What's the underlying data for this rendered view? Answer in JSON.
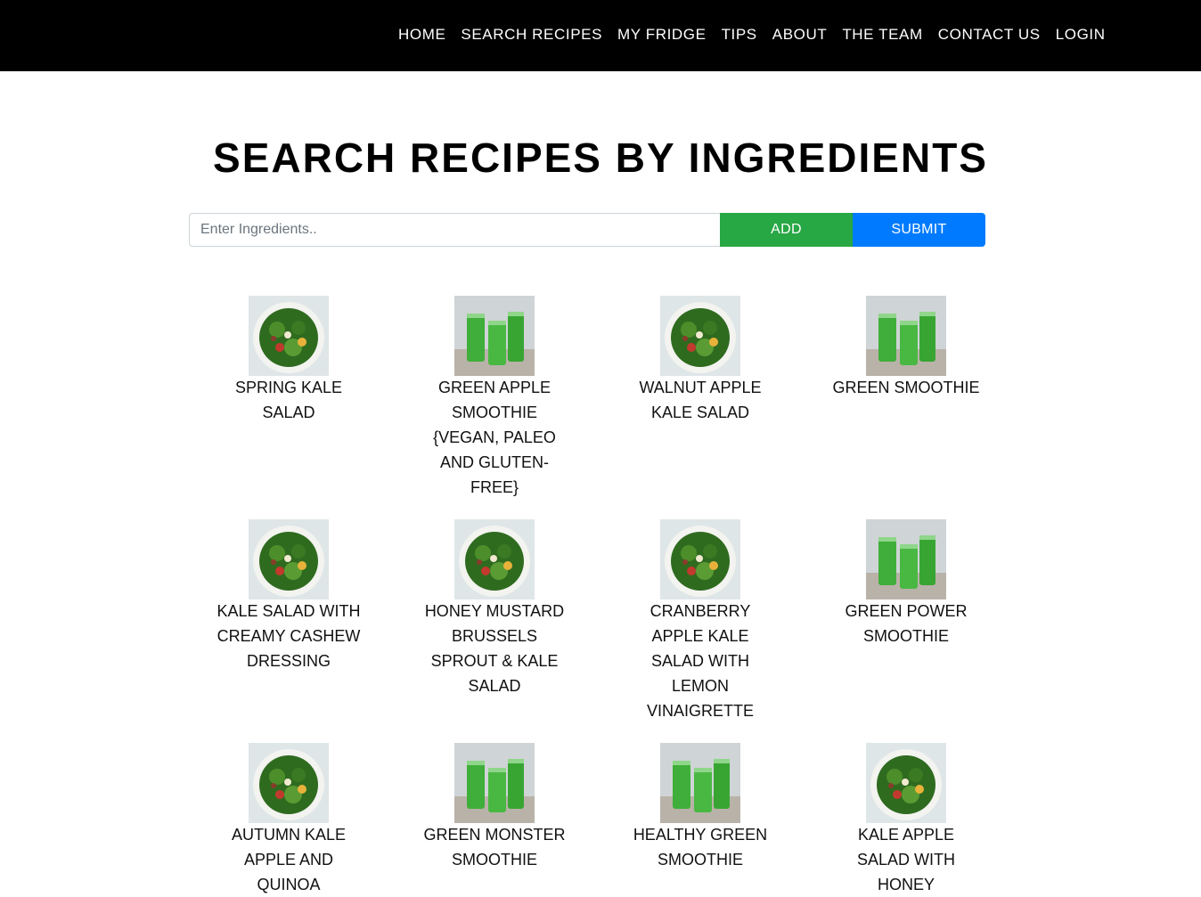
{
  "nav": {
    "items": [
      "HOME",
      "SEARCH RECIPES",
      "MY FRIDGE",
      "TIPS",
      "ABOUT",
      "THE TEAM",
      "CONTACT US",
      "LOGIN"
    ]
  },
  "page": {
    "title": "SEARCH RECIPES BY INGREDIENTS"
  },
  "search": {
    "placeholder": "Enter Ingredients..",
    "value": "",
    "add_label": "ADD",
    "submit_label": "SUBMIT"
  },
  "colors": {
    "navbar": "#000000",
    "add_button": "#28a745",
    "submit_button": "#007bff"
  },
  "recipes": [
    {
      "title": "SPRING KALE SALAD",
      "image": "salad-photo"
    },
    {
      "title": "GREEN APPLE SMOOTHIE {VEGAN, PALEO AND GLUTEN-FREE}",
      "image": "smoothie-photo"
    },
    {
      "title": "WALNUT APPLE KALE SALAD",
      "image": "salad-photo"
    },
    {
      "title": "GREEN SMOOTHIE",
      "image": "smoothie-photo"
    },
    {
      "title": "KALE SALAD WITH CREAMY CASHEW DRESSING",
      "image": "salad-photo"
    },
    {
      "title": "HONEY MUSTARD BRUSSELS SPROUT & KALE SALAD",
      "image": "salad-photo"
    },
    {
      "title": "CRANBERRY APPLE KALE SALAD WITH LEMON VINAIGRETTE",
      "image": "salad-photo"
    },
    {
      "title": "GREEN POWER SMOOTHIE",
      "image": "smoothie-photo"
    },
    {
      "title": "AUTUMN KALE APPLE AND QUINOA",
      "image": "salad-photo"
    },
    {
      "title": "GREEN MONSTER SMOOTHIE",
      "image": "smoothie-photo"
    },
    {
      "title": "HEALTHY GREEN SMOOTHIE",
      "image": "smoothie-photo"
    },
    {
      "title": "KALE APPLE SALAD WITH HONEY",
      "image": "salad-photo"
    }
  ]
}
